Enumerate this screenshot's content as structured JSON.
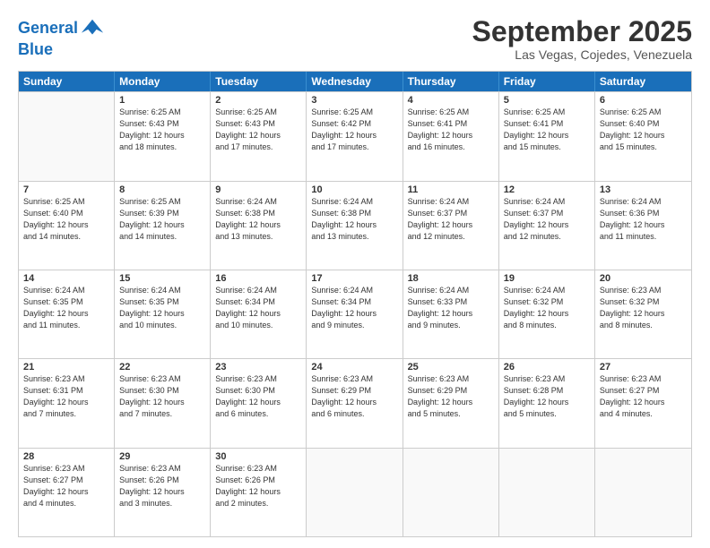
{
  "header": {
    "logo_line1": "General",
    "logo_line2": "Blue",
    "month": "September 2025",
    "location": "Las Vegas, Cojedes, Venezuela"
  },
  "weekdays": [
    "Sunday",
    "Monday",
    "Tuesday",
    "Wednesday",
    "Thursday",
    "Friday",
    "Saturday"
  ],
  "weeks": [
    [
      {
        "day": "",
        "info": ""
      },
      {
        "day": "1",
        "info": "Sunrise: 6:25 AM\nSunset: 6:43 PM\nDaylight: 12 hours\nand 18 minutes."
      },
      {
        "day": "2",
        "info": "Sunrise: 6:25 AM\nSunset: 6:43 PM\nDaylight: 12 hours\nand 17 minutes."
      },
      {
        "day": "3",
        "info": "Sunrise: 6:25 AM\nSunset: 6:42 PM\nDaylight: 12 hours\nand 17 minutes."
      },
      {
        "day": "4",
        "info": "Sunrise: 6:25 AM\nSunset: 6:41 PM\nDaylight: 12 hours\nand 16 minutes."
      },
      {
        "day": "5",
        "info": "Sunrise: 6:25 AM\nSunset: 6:41 PM\nDaylight: 12 hours\nand 15 minutes."
      },
      {
        "day": "6",
        "info": "Sunrise: 6:25 AM\nSunset: 6:40 PM\nDaylight: 12 hours\nand 15 minutes."
      }
    ],
    [
      {
        "day": "7",
        "info": "Sunrise: 6:25 AM\nSunset: 6:40 PM\nDaylight: 12 hours\nand 14 minutes."
      },
      {
        "day": "8",
        "info": "Sunrise: 6:25 AM\nSunset: 6:39 PM\nDaylight: 12 hours\nand 14 minutes."
      },
      {
        "day": "9",
        "info": "Sunrise: 6:24 AM\nSunset: 6:38 PM\nDaylight: 12 hours\nand 13 minutes."
      },
      {
        "day": "10",
        "info": "Sunrise: 6:24 AM\nSunset: 6:38 PM\nDaylight: 12 hours\nand 13 minutes."
      },
      {
        "day": "11",
        "info": "Sunrise: 6:24 AM\nSunset: 6:37 PM\nDaylight: 12 hours\nand 12 minutes."
      },
      {
        "day": "12",
        "info": "Sunrise: 6:24 AM\nSunset: 6:37 PM\nDaylight: 12 hours\nand 12 minutes."
      },
      {
        "day": "13",
        "info": "Sunrise: 6:24 AM\nSunset: 6:36 PM\nDaylight: 12 hours\nand 11 minutes."
      }
    ],
    [
      {
        "day": "14",
        "info": "Sunrise: 6:24 AM\nSunset: 6:35 PM\nDaylight: 12 hours\nand 11 minutes."
      },
      {
        "day": "15",
        "info": "Sunrise: 6:24 AM\nSunset: 6:35 PM\nDaylight: 12 hours\nand 10 minutes."
      },
      {
        "day": "16",
        "info": "Sunrise: 6:24 AM\nSunset: 6:34 PM\nDaylight: 12 hours\nand 10 minutes."
      },
      {
        "day": "17",
        "info": "Sunrise: 6:24 AM\nSunset: 6:34 PM\nDaylight: 12 hours\nand 9 minutes."
      },
      {
        "day": "18",
        "info": "Sunrise: 6:24 AM\nSunset: 6:33 PM\nDaylight: 12 hours\nand 9 minutes."
      },
      {
        "day": "19",
        "info": "Sunrise: 6:24 AM\nSunset: 6:32 PM\nDaylight: 12 hours\nand 8 minutes."
      },
      {
        "day": "20",
        "info": "Sunrise: 6:23 AM\nSunset: 6:32 PM\nDaylight: 12 hours\nand 8 minutes."
      }
    ],
    [
      {
        "day": "21",
        "info": "Sunrise: 6:23 AM\nSunset: 6:31 PM\nDaylight: 12 hours\nand 7 minutes."
      },
      {
        "day": "22",
        "info": "Sunrise: 6:23 AM\nSunset: 6:30 PM\nDaylight: 12 hours\nand 7 minutes."
      },
      {
        "day": "23",
        "info": "Sunrise: 6:23 AM\nSunset: 6:30 PM\nDaylight: 12 hours\nand 6 minutes."
      },
      {
        "day": "24",
        "info": "Sunrise: 6:23 AM\nSunset: 6:29 PM\nDaylight: 12 hours\nand 6 minutes."
      },
      {
        "day": "25",
        "info": "Sunrise: 6:23 AM\nSunset: 6:29 PM\nDaylight: 12 hours\nand 5 minutes."
      },
      {
        "day": "26",
        "info": "Sunrise: 6:23 AM\nSunset: 6:28 PM\nDaylight: 12 hours\nand 5 minutes."
      },
      {
        "day": "27",
        "info": "Sunrise: 6:23 AM\nSunset: 6:27 PM\nDaylight: 12 hours\nand 4 minutes."
      }
    ],
    [
      {
        "day": "28",
        "info": "Sunrise: 6:23 AM\nSunset: 6:27 PM\nDaylight: 12 hours\nand 4 minutes."
      },
      {
        "day": "29",
        "info": "Sunrise: 6:23 AM\nSunset: 6:26 PM\nDaylight: 12 hours\nand 3 minutes."
      },
      {
        "day": "30",
        "info": "Sunrise: 6:23 AM\nSunset: 6:26 PM\nDaylight: 12 hours\nand 2 minutes."
      },
      {
        "day": "",
        "info": ""
      },
      {
        "day": "",
        "info": ""
      },
      {
        "day": "",
        "info": ""
      },
      {
        "day": "",
        "info": ""
      }
    ]
  ]
}
